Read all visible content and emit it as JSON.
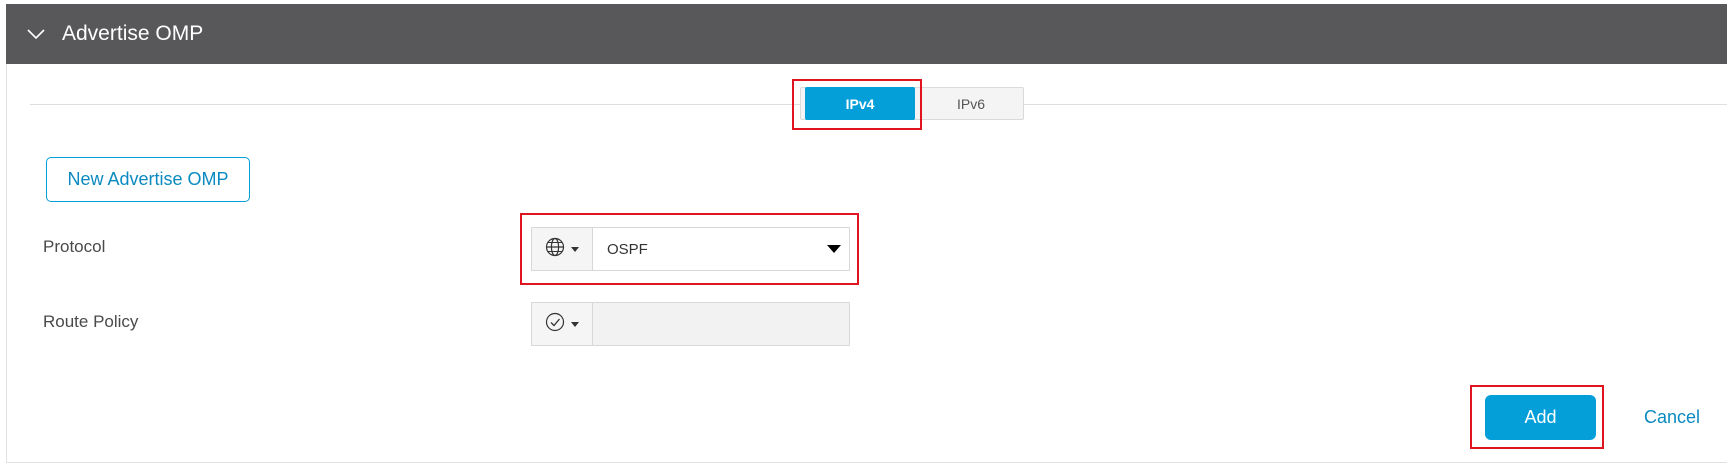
{
  "section": {
    "title": "Advertise OMP",
    "collapse_icon": "chevron-down-icon"
  },
  "tabs": [
    {
      "label": "IPv4",
      "active": true
    },
    {
      "label": "IPv6",
      "active": false
    }
  ],
  "new_button_label": "New Advertise OMP",
  "fields": {
    "protocol": {
      "label": "Protocol",
      "scope_icon": "globe-icon",
      "value": "OSPF"
    },
    "route_policy": {
      "label": "Route Policy",
      "scope_icon": "check-circle-icon",
      "value": ""
    }
  },
  "actions": {
    "add_label": "Add",
    "cancel_label": "Cancel"
  },
  "colors": {
    "header_bg": "#58585a",
    "accent": "#049fd9",
    "link": "#0a8ac0",
    "highlight": "#e0141e"
  }
}
